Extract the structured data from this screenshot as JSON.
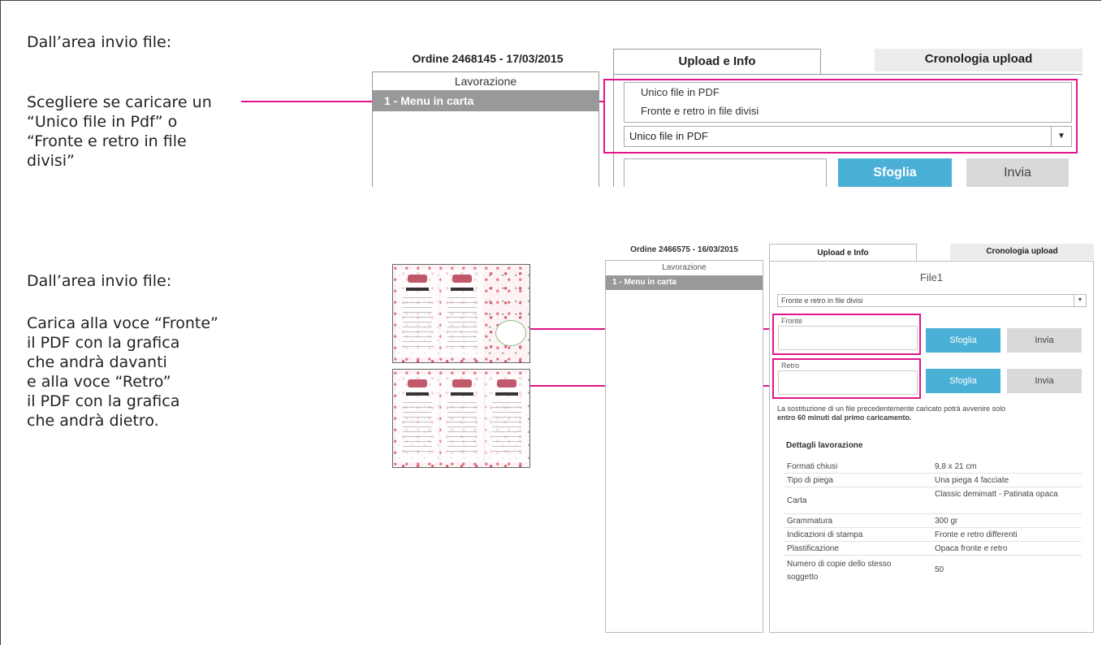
{
  "section1": {
    "intro": "Dall’area invio file:",
    "instruction": "Scegliere se caricare un\n“Unico file in Pdf” o\n“Fronte e retro in file\ndivisi”",
    "order_title": "Ordine 2468145 - 17/03/2015",
    "tabs": [
      "Upload e Info",
      "Cronologia upload"
    ],
    "list_header": "Lavorazione",
    "list_item": "1  -  Menu in carta",
    "options": [
      "Unico file in PDF",
      "Fronte e retro in file divisi"
    ],
    "select_value": "Unico file in PDF",
    "browse_label": "Sfoglia",
    "send_label": "Invia"
  },
  "section2": {
    "intro": "Dall’area invio file:",
    "instruction": "Carica alla voce “Fronte”\nil PDF con la grafica\nche andrà davanti\ne alla voce “Retro”\nil PDF con la grafica\nche andrà dietro.",
    "order_title": "Ordine 2466575 - 16/03/2015",
    "tabs": [
      "Upload e Info",
      "Cronologia upload"
    ],
    "list_header": "Lavorazione",
    "list_item": "1 - Menu in carta",
    "file_title": "File1",
    "select_value": "Fronte e retro in file divisi",
    "front_label": "Fronte",
    "back_label": "Retro",
    "browse_label": "Sfoglia",
    "send_label": "Invia",
    "notice_text": "La sostituzione di un file precedentemente caricato potrà avvenire solo",
    "notice_bold": "entro 60 minuti dal primo caricamento.",
    "details_title": "Dettagli lavorazione",
    "details": [
      {
        "label": "Formati chiusi",
        "value": "9,8 x 21 cm"
      },
      {
        "label": "Tipo di piega",
        "value": "Una piega 4 facciate"
      },
      {
        "label": "Carta",
        "value": "Classic demimatt - Patinata opaca"
      },
      {
        "label": "Grammatura",
        "value": "300 gr"
      },
      {
        "label": "Indicazioni di stampa",
        "value": "Fronte e retro differenti"
      },
      {
        "label": "Plastificazione",
        "value": "Opaca fronte e retro"
      },
      {
        "label": "Numero di copie dello stesso soggetto",
        "value": "50"
      }
    ]
  },
  "colors": {
    "accent": "#e0158a",
    "button_blue": "#4bb0d6",
    "selected_grey": "#999999"
  },
  "icons": [
    "dropdown-arrow-icon"
  ]
}
